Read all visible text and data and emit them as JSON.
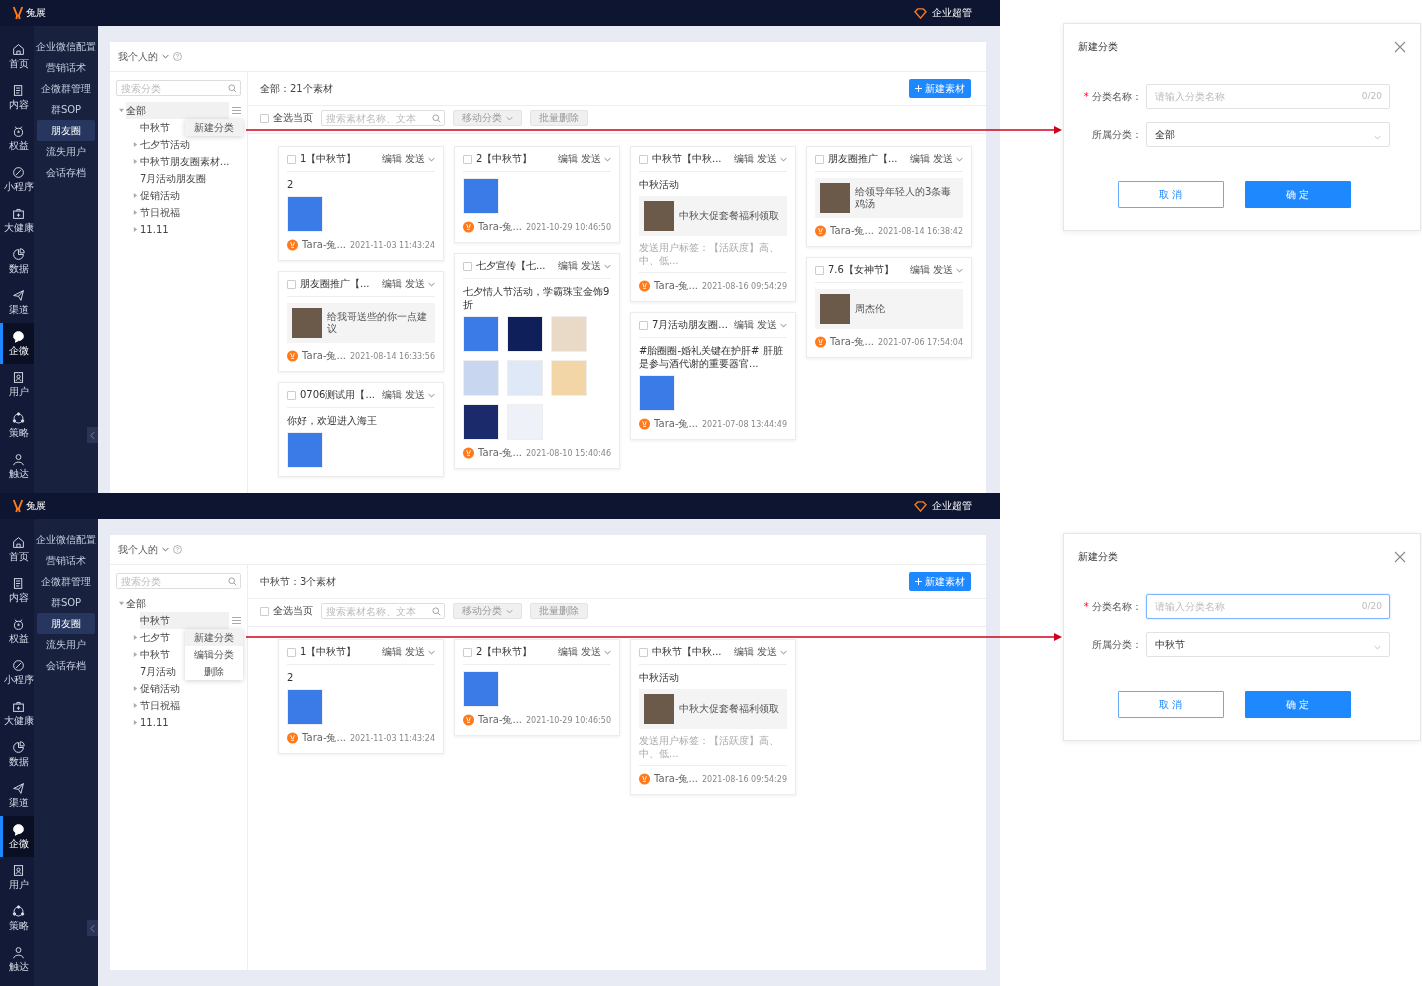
{
  "screens": [
    {
      "logo": "兔展",
      "user": "企业超管",
      "nav": [
        {
          "label": "首页",
          "selected": false
        },
        {
          "label": "内容",
          "selected": false
        },
        {
          "label": "权益",
          "selected": false
        },
        {
          "label": "小程序",
          "selected": false
        },
        {
          "label": "大健康",
          "selected": false
        },
        {
          "label": "数据",
          "selected": false
        },
        {
          "label": "渠道",
          "selected": false
        },
        {
          "label": "企微",
          "selected": true
        },
        {
          "label": "用户",
          "selected": false
        },
        {
          "label": "策略",
          "selected": false
        },
        {
          "label": "触达",
          "selected": false
        }
      ],
      "subnav": [
        {
          "label": "企业微信配置",
          "selected": false
        },
        {
          "label": "营销话术",
          "selected": false
        },
        {
          "label": "企微群管理",
          "selected": false
        },
        {
          "label": "群SOP",
          "selected": false
        },
        {
          "label": "朋友圈",
          "selected": true
        },
        {
          "label": "流失用户",
          "selected": false
        },
        {
          "label": "会话存档",
          "selected": false
        }
      ],
      "scope": "我个人的",
      "tree_search": {
        "placeholder": "搜索分类"
      },
      "tree": [
        {
          "label": "全部",
          "kind": "folder",
          "expanded": true,
          "selected": true,
          "children": [
            {
              "label": "中秋节",
              "kind": "leaf",
              "selected": false
            },
            {
              "label": "七夕节活动",
              "kind": "folder",
              "expanded": false,
              "selected": false
            },
            {
              "label": "中秋节朋友圈素材...",
              "kind": "folder",
              "expanded": false,
              "selected": false
            },
            {
              "label": "7月活动朋友圈",
              "kind": "leaf",
              "selected": false
            },
            {
              "label": "促销活动",
              "kind": "folder",
              "expanded": false,
              "selected": false
            },
            {
              "label": "节日祝福",
              "kind": "folder",
              "expanded": false,
              "selected": false
            },
            {
              "label": "11.11",
              "kind": "folder",
              "expanded": false,
              "selected": false
            }
          ]
        }
      ],
      "menu": [
        {
          "label": "新建分类",
          "selected": true
        }
      ],
      "summary": "全部：21个素材",
      "new_button": "新建素材",
      "select_all": {
        "label": "全选当页",
        "checked": false
      },
      "search": {
        "placeholder": "搜索素材名称、文本"
      },
      "move_button": "移动分类",
      "delete_button": "批量删除",
      "columns": [
        [
          {
            "title": "1【中秋节】",
            "checked": false,
            "actions": [
              "编辑",
              "发送"
            ],
            "text": "2",
            "media": [
              {
                "kind": "image"
              }
            ],
            "author": "Tara-兔...",
            "time": "2021-11-03 11:43:24"
          },
          {
            "title": "朋友圈推广【...",
            "checked": false,
            "actions": [
              "编辑",
              "发送"
            ],
            "media": [
              {
                "kind": "link",
                "text": "给我哥送些的你一点建议"
              }
            ],
            "author": "Tara-兔...",
            "time": "2021-08-14 16:33:56"
          },
          {
            "title": "0706测试用【...",
            "checked": false,
            "actions": [
              "编辑",
              "发送"
            ],
            "text": "你好，欢迎进入海王",
            "media": [
              {
                "kind": "image"
              }
            ]
          }
        ],
        [
          {
            "title": "2【中秋节】",
            "checked": false,
            "actions": [
              "编辑",
              "发送"
            ],
            "media": [
              {
                "kind": "image"
              }
            ],
            "author": "Tara-兔...",
            "time": "2021-10-29 10:46:50"
          },
          {
            "title": "七夕宣传【七...",
            "checked": false,
            "actions": [
              "编辑",
              "发送"
            ],
            "text": "七夕情人节活动，学霸珠宝金饰9折",
            "media": [
              {
                "kind": "image"
              },
              {
                "kind": "image"
              },
              {
                "kind": "image"
              },
              {
                "kind": "image"
              },
              {
                "kind": "image"
              },
              {
                "kind": "image"
              },
              {
                "kind": "image"
              },
              {
                "kind": "image"
              }
            ],
            "author": "Tara-兔...",
            "time": "2021-08-10 15:40:46"
          }
        ],
        [
          {
            "title": "中秋节【中秋...",
            "checked": false,
            "actions": [
              "编辑",
              "发送"
            ],
            "text": "中秋活动",
            "media": [
              {
                "kind": "link",
                "text": "中秋大促套餐福利领取"
              }
            ],
            "tags": "发送用户标签：【活跃度】高、中、低...",
            "author": "Tara-兔...",
            "time": "2021-08-16 09:54:29"
          },
          {
            "title": "7月活动朋友圈...",
            "checked": false,
            "actions": [
              "编辑",
              "发送"
            ],
            "text": "#胎圈圈-婚礼关键在护肝# 肝脏是参与酒代谢的重要器官...",
            "media": [
              {
                "kind": "image"
              }
            ],
            "author": "Tara-兔...",
            "time": "2021-07-08 13:44:49"
          }
        ],
        [
          {
            "title": "朋友圈推广【...",
            "checked": false,
            "actions": [
              "编辑",
              "发送"
            ],
            "media": [
              {
                "kind": "link",
                "text": "给领导年轻人的3条毒鸡汤"
              }
            ],
            "author": "Tara-兔...",
            "time": "2021-08-14 16:38:42"
          },
          {
            "title": "7.6【女神节】",
            "checked": false,
            "actions": [
              "编辑",
              "发送"
            ],
            "media": [
              {
                "kind": "link",
                "text": "周杰伦"
              }
            ],
            "author": "Tara-兔...",
            "time": "2021-07-06 17:54:04"
          }
        ]
      ]
    },
    {
      "logo": "兔展",
      "user": "企业超管",
      "nav": [
        {
          "label": "首页",
          "selected": false
        },
        {
          "label": "内容",
          "selected": false
        },
        {
          "label": "权益",
          "selected": false
        },
        {
          "label": "小程序",
          "selected": false
        },
        {
          "label": "大健康",
          "selected": false
        },
        {
          "label": "数据",
          "selected": false
        },
        {
          "label": "渠道",
          "selected": false
        },
        {
          "label": "企微",
          "selected": true
        },
        {
          "label": "用户",
          "selected": false
        },
        {
          "label": "策略",
          "selected": false
        },
        {
          "label": "触达",
          "selected": false
        }
      ],
      "subnav": [
        {
          "label": "企业微信配置",
          "selected": false
        },
        {
          "label": "营销话术",
          "selected": false
        },
        {
          "label": "企微群管理",
          "selected": false
        },
        {
          "label": "群SOP",
          "selected": false
        },
        {
          "label": "朋友圈",
          "selected": true
        },
        {
          "label": "流失用户",
          "selected": false
        },
        {
          "label": "会话存档",
          "selected": false
        }
      ],
      "scope": "我个人的",
      "tree_search": {
        "placeholder": "搜索分类"
      },
      "tree": [
        {
          "label": "全部",
          "kind": "folder",
          "expanded": true,
          "selected": false,
          "children": [
            {
              "label": "中秋节",
              "kind": "leaf",
              "selected": true
            },
            {
              "label": "七夕节",
              "kind": "folder",
              "expanded": false,
              "selected": false
            },
            {
              "label": "中秋节",
              "kind": "folder",
              "expanded": false,
              "selected": false
            },
            {
              "label": "7月活动",
              "kind": "leaf",
              "selected": false
            },
            {
              "label": "促销活动",
              "kind": "folder",
              "expanded": false,
              "selected": false
            },
            {
              "label": "节日祝福",
              "kind": "folder",
              "expanded": false,
              "selected": false
            },
            {
              "label": "11.11",
              "kind": "folder",
              "expanded": false,
              "selected": false
            }
          ]
        }
      ],
      "menu": [
        {
          "label": "新建分类",
          "selected": true
        },
        {
          "label": "编辑分类",
          "selected": false
        },
        {
          "label": "删除",
          "selected": false
        }
      ],
      "summary": "中秋节：3个素材",
      "new_button": "新建素材",
      "select_all": {
        "label": "全选当页",
        "checked": false
      },
      "search": {
        "placeholder": "搜索素材名称、文本"
      },
      "move_button": "移动分类",
      "delete_button": "批量删除",
      "columns": [
        [
          {
            "title": "1【中秋节】",
            "checked": false,
            "actions": [
              "编辑",
              "发送"
            ],
            "text": "2",
            "media": [
              {
                "kind": "image"
              }
            ],
            "author": "Tara-兔...",
            "time": "2021-11-03 11:43:24"
          }
        ],
        [
          {
            "title": "2【中秋节】",
            "checked": false,
            "actions": [
              "编辑",
              "发送"
            ],
            "media": [
              {
                "kind": "image"
              }
            ],
            "author": "Tara-兔...",
            "time": "2021-10-29 10:46:50"
          }
        ],
        [
          {
            "title": "中秋节【中秋...",
            "checked": false,
            "actions": [
              "编辑",
              "发送"
            ],
            "text": "中秋活动",
            "media": [
              {
                "kind": "link",
                "text": "中秋大促套餐福利领取"
              }
            ],
            "tags": "发送用户标签：【活跃度】高、中、低...",
            "author": "Tara-兔...",
            "time": "2021-08-16 09:54:29"
          }
        ]
      ]
    }
  ],
  "dialogs": [
    {
      "title": "新建分类",
      "name_label": "分类名称：",
      "required_mark": "*",
      "name_placeholder": "请输入分类名称",
      "counter": "0/20",
      "focused": false,
      "parent_label": "所属分类：",
      "parent_value": "全部",
      "cancel": "取 消",
      "ok": "确 定"
    },
    {
      "title": "新建分类",
      "name_label": "分类名称：",
      "required_mark": "*",
      "name_placeholder": "请输入分类名称",
      "counter": "0/20",
      "focused": true,
      "parent_label": "所属分类：",
      "parent_value": "中秋节",
      "cancel": "取 消",
      "ok": "确 定"
    }
  ]
}
